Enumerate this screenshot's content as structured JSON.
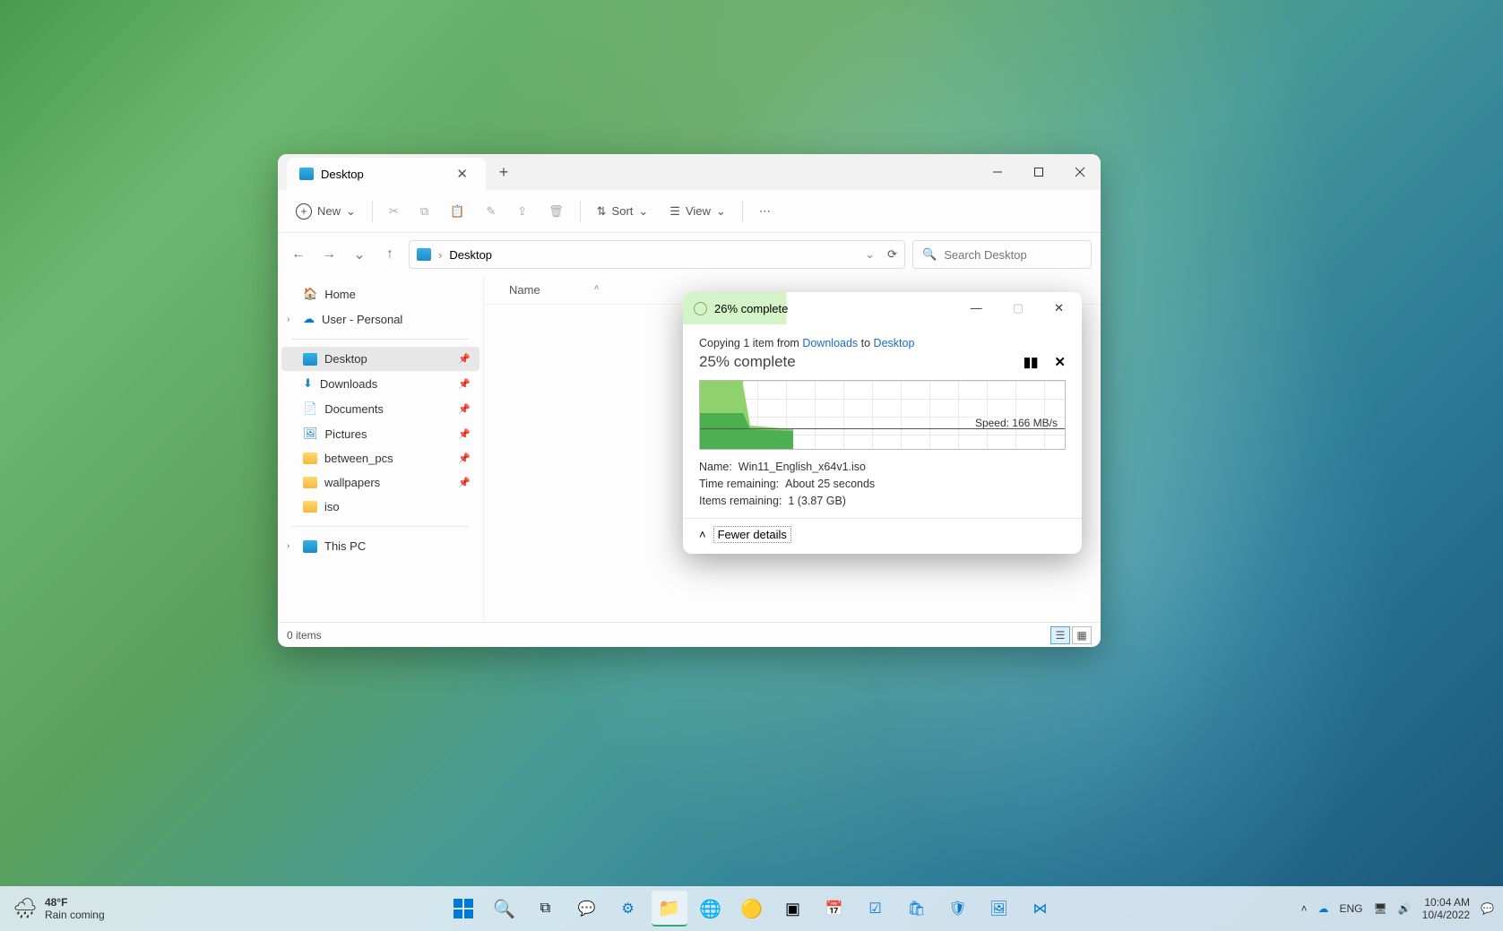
{
  "explorer": {
    "tab": {
      "title": "Desktop"
    },
    "toolbar": {
      "new": "New",
      "sort": "Sort",
      "view": "View"
    },
    "breadcrumb": "Desktop",
    "search_placeholder": "Search Desktop",
    "sidebar": {
      "home": "Home",
      "user": "User - Personal",
      "desktop": "Desktop",
      "downloads": "Downloads",
      "documents": "Documents",
      "pictures": "Pictures",
      "between_pcs": "between_pcs",
      "wallpapers": "wallpapers",
      "iso": "iso",
      "thispc": "This PC"
    },
    "columns": {
      "name": "Name"
    },
    "status": "0 items"
  },
  "copy": {
    "title_percent": "26% complete",
    "info_prefix": "Copying 1 item from ",
    "info_from": "Downloads",
    "info_mid": " to ",
    "info_to": "Desktop",
    "progress": "25% complete",
    "speed": "Speed: 166 MB/s",
    "name_label": "Name:",
    "name_value": "Win11_English_x64v1.iso",
    "time_label": "Time remaining:",
    "time_value": "About 25 seconds",
    "items_label": "Items remaining:",
    "items_value": "1 (3.87 GB)",
    "fewer": "Fewer details"
  },
  "taskbar": {
    "temp": "48°F",
    "weather": "Rain coming",
    "lang": "ENG",
    "time": "10:04 AM",
    "date": "10/4/2022"
  },
  "chart_data": {
    "type": "area",
    "title": "Copy transfer speed",
    "xlabel": "",
    "ylabel": "MB/s",
    "ylim": [
      0,
      600
    ],
    "x": [
      0,
      1,
      2,
      3,
      4,
      5,
      6,
      7,
      8,
      9,
      10,
      11,
      12
    ],
    "values": [
      580,
      580,
      580,
      580,
      580,
      580,
      180,
      170,
      168,
      168,
      166,
      166,
      166
    ]
  }
}
